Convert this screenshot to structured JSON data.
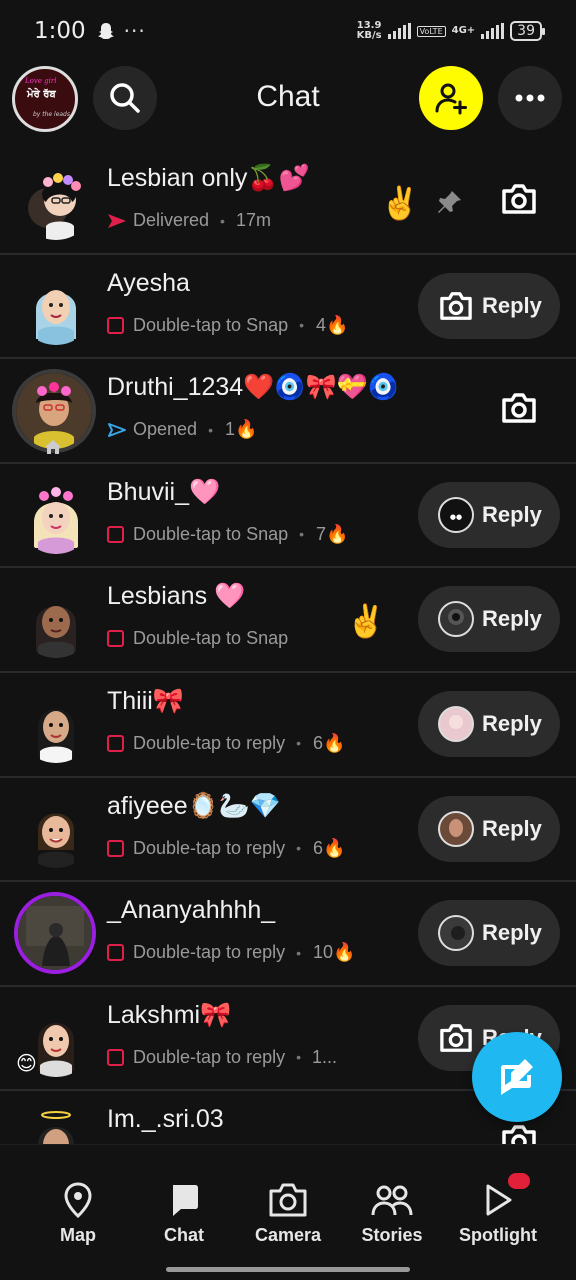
{
  "status_bar": {
    "time": "1:00",
    "dots": "···",
    "speed_value": "13.9",
    "speed_unit": "KB/s",
    "network": "4G+",
    "volte": "VoLTE",
    "battery": "39"
  },
  "header": {
    "title": "Chat",
    "bitmoji_lines": [
      "Love girl",
      "ਮੇਰੇ ਰੱਬ",
      "by the leads"
    ]
  },
  "chats": [
    {
      "name": "Lesbian only🍒💕",
      "status": "Delivered",
      "time": "17m",
      "streak": "",
      "action": "camera",
      "extra": "✌️"
    },
    {
      "name": "Ayesha",
      "status": "Double-tap to Snap",
      "streak": "4🔥",
      "action": "Reply"
    },
    {
      "name": "Druthi_1234❤️🧿🎀💝🧿",
      "status": "Opened",
      "streak": "1🔥",
      "action": "camera"
    },
    {
      "name": "Bhuvii_🩷",
      "status": "Double-tap to Snap",
      "streak": "7🔥",
      "action": "Reply"
    },
    {
      "name": "Lesbians 🩷",
      "status": "Double-tap to Snap",
      "streak": "",
      "action": "Reply",
      "extra": "✌️"
    },
    {
      "name": "Thiii🎀",
      "status": "Double-tap to reply",
      "streak": "6🔥",
      "action": "Reply"
    },
    {
      "name": "afiyeee🪞🦢💎",
      "status": "Double-tap to reply",
      "streak": "6🔥",
      "action": "Reply"
    },
    {
      "name": "_Ananyahhhh_",
      "status": "Double-tap to reply",
      "streak": "10🔥",
      "action": "Reply"
    },
    {
      "name": "Lakshmi🎀",
      "status": "Double-tap to reply",
      "streak": "1...",
      "action": "Reply",
      "extra": "😊"
    },
    {
      "name": "Im._.sri.03",
      "status": "",
      "streak": "",
      "action": "camera"
    }
  ],
  "separator": "•",
  "nav": {
    "map": "Map",
    "chat": "Chat",
    "camera": "Camera",
    "stories": "Stories",
    "spotlight": "Spotlight"
  },
  "colors": {
    "background": "#121212",
    "add_friend": "#fffc00",
    "fab": "#1fb8f0",
    "unread": "#e0204a",
    "opened": "#3aa6e8",
    "story_ring": "#9b1fe0"
  }
}
